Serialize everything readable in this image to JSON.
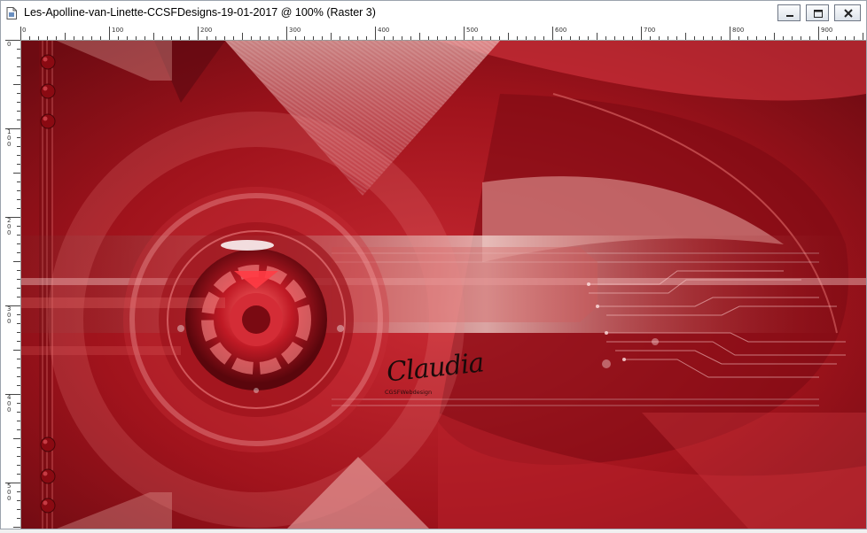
{
  "window": {
    "title": "Les-Apolline-van-Linette-CCSFDesigns-19-01-2017 @ 100% (Raster 3)",
    "controls": [
      "minimize-icon",
      "restore-icon",
      "close-icon"
    ]
  },
  "ruler": {
    "top_labels": [
      "0",
      "100",
      "200",
      "300",
      "400",
      "500",
      "600",
      "700",
      "800",
      "900"
    ],
    "left_labels": [
      "0",
      "100",
      "200",
      "300",
      "400",
      "500"
    ]
  },
  "canvas": {
    "signature": "Claudia",
    "signature_sub": "CGSFWebdesign",
    "colors": {
      "base": "#a0131c",
      "dark": "#5a0a10",
      "light": "#e8a0a0",
      "highlight": "#ffffff"
    }
  }
}
